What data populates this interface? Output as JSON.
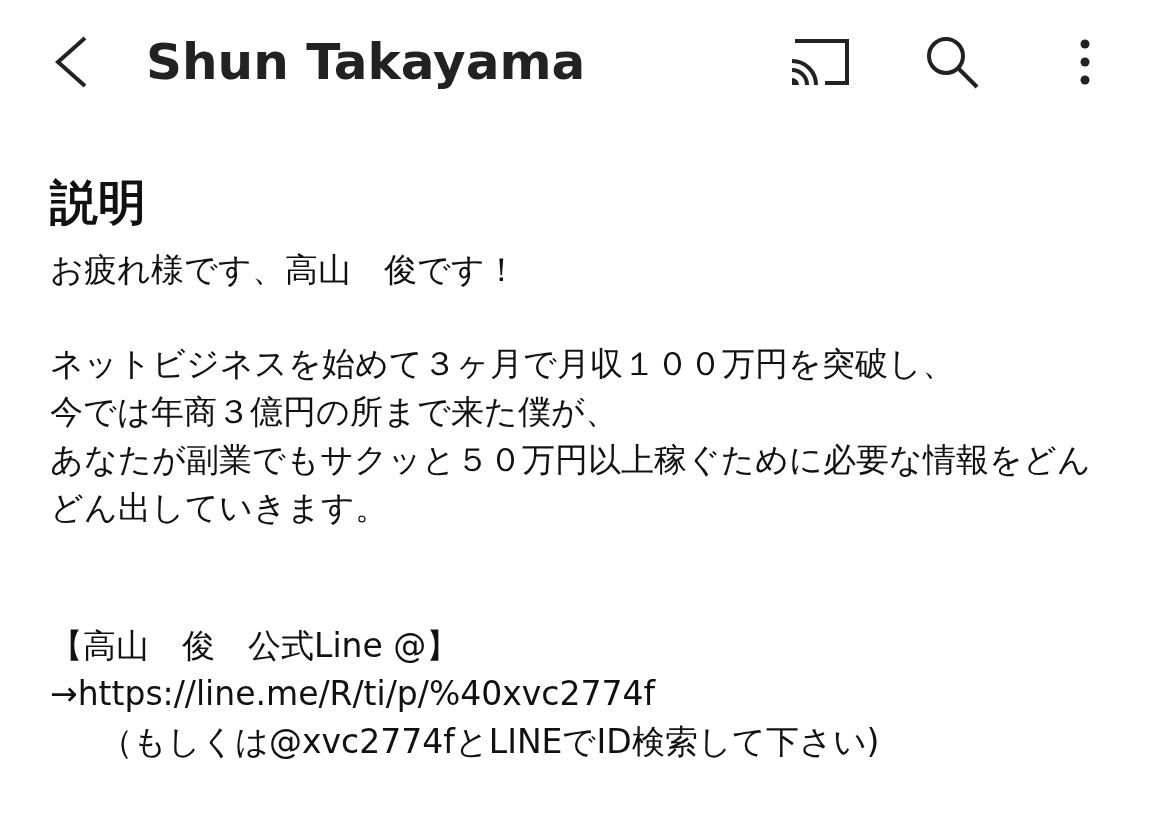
{
  "app_bar": {
    "title": "Shun Takayama"
  },
  "description": {
    "heading": "説明",
    "paragraphs": [
      {
        "kind": "text",
        "lines": [
          "お疲れ様です、高山　俊です！"
        ]
      },
      {
        "kind": "text",
        "lines": [
          "ネットビジネスを始めて３ヶ月で月収１００万円を突破し、",
          "今では年商３億円の所まで来た僕が、",
          "あなたが副業でもサクッと５０万円以上稼ぐために必要な情報をどんどん出していきます。"
        ]
      },
      {
        "kind": "contact",
        "title": "【高山　俊　公式Line @】",
        "link": "→https://line.me/R/ti/p/%40xvc2774f",
        "note": "（もしくは@xvc2774fとLINEでID検索して下さい)"
      }
    ]
  }
}
